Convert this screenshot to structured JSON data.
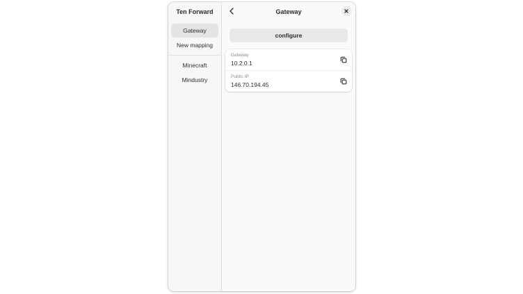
{
  "sidebar": {
    "title": "Ten Forward",
    "items": [
      {
        "label": "Gateway",
        "selected": true
      },
      {
        "label": "New mapping",
        "selected": false
      }
    ],
    "mappings": [
      {
        "label": "Minecraft"
      },
      {
        "label": "Mindustry"
      }
    ]
  },
  "header": {
    "title": "Gateway",
    "back_icon": "chevron-left-icon",
    "close_icon": "close-icon"
  },
  "configure_label": "configure",
  "info": [
    {
      "label": "Gateway",
      "value": "10.2.0.1",
      "icon": "copy-icon"
    },
    {
      "label": "Public IP",
      "value": "146.70.194.45",
      "icon": "copy-icon"
    }
  ],
  "colors": {
    "window_bg": "#fafafa",
    "sidebar_bg": "#f7f7f7",
    "selected_bg": "#e4e4e4",
    "button_bg": "#e8e8e8",
    "card_bg": "#ffffff",
    "text": "#2e2e2e",
    "subtle_text": "#8a8a8a"
  }
}
